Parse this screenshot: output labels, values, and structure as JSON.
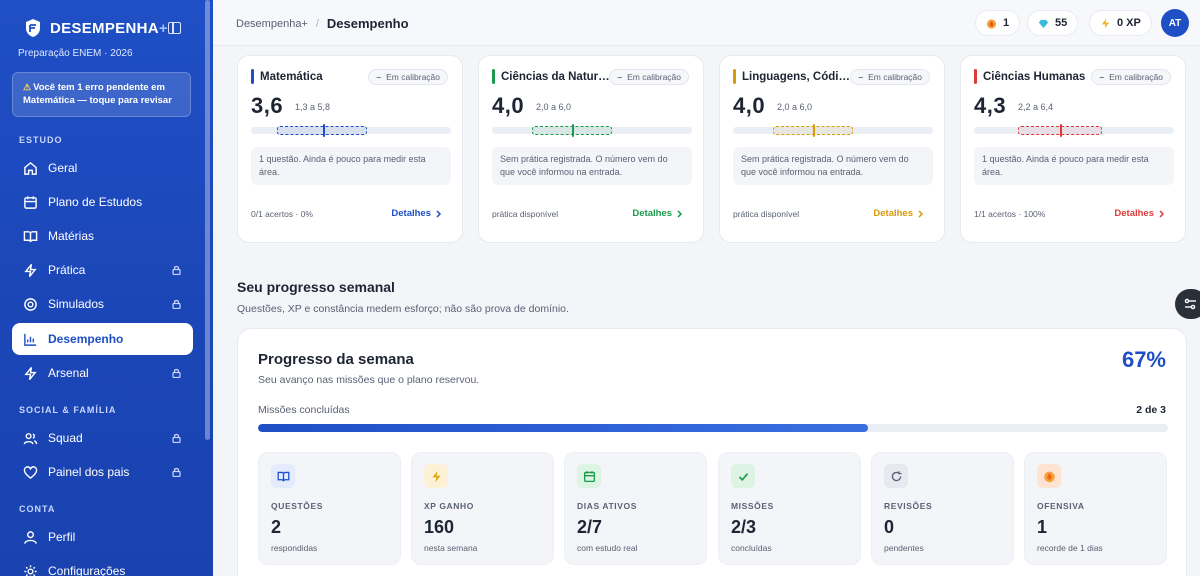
{
  "sidebar": {
    "brand": "DESEMPENHA",
    "brand_plus": "+",
    "subtitle": "Preparação ENEM · 2026",
    "alert": "Você tem 1 erro pendente em Matemática — toque para revisar",
    "sections": {
      "estudo": "ESTUDO",
      "social": "SOCIAL & FAMÍLIA",
      "conta": "CONTA"
    },
    "items": [
      {
        "label": "Geral",
        "icon": "home-icon",
        "locked": false
      },
      {
        "label": "Plano de Estudos",
        "icon": "calendar-icon",
        "locked": false
      },
      {
        "label": "Matérias",
        "icon": "book-icon",
        "locked": false
      },
      {
        "label": "Prática",
        "icon": "bolt-icon",
        "locked": true
      },
      {
        "label": "Simulados",
        "icon": "target-icon",
        "locked": true
      },
      {
        "label": "Desempenho",
        "icon": "chart-icon",
        "locked": false,
        "active": true
      },
      {
        "label": "Arsenal",
        "icon": "bolt-icon",
        "locked": true
      },
      {
        "label": "Squad",
        "icon": "users-icon",
        "locked": true
      },
      {
        "label": "Painel dos pais",
        "icon": "heart-icon",
        "locked": true
      },
      {
        "label": "Perfil",
        "icon": "user-icon",
        "locked": false
      },
      {
        "label": "Configurações",
        "icon": "gear-icon",
        "locked": false
      }
    ]
  },
  "header": {
    "breadcrumb_root": "Desempenha+",
    "breadcrumb_sep": "/",
    "breadcrumb_current": "Desempenho",
    "streak": "1",
    "gems": "55",
    "xp": "0 XP",
    "avatar": "AT"
  },
  "subjects": [
    {
      "title": "Matemática",
      "status": "Em calibração",
      "score": "3,6",
      "range": "1,3 a 5,8",
      "band_low": 1.3,
      "band_high": 5.8,
      "value": 3.6,
      "note": "1 questão. Ainda é pouco para medir esta área.",
      "footer": "0/1 acertos · 0%",
      "details": "Detalhes",
      "color": "#1e4fc4"
    },
    {
      "title": "Ciências da Natureza",
      "status": "Em calibração",
      "score": "4,0",
      "range": "2,0 a 6,0",
      "band_low": 2.0,
      "band_high": 6.0,
      "value": 4.0,
      "note": "Sem prática registrada. O número vem do que você informou na entrada.",
      "footer": "prática disponível",
      "details": "Detalhes",
      "color": "#1a9a4a"
    },
    {
      "title": "Linguagens, Códigos",
      "status": "Em calibração",
      "score": "4,0",
      "range": "2,0 a 6,0",
      "band_low": 2.0,
      "band_high": 6.0,
      "value": 4.0,
      "note": "Sem prática registrada. O número vem do que você informou na entrada.",
      "footer": "prática disponível",
      "details": "Detalhes",
      "color": "#d99a0a"
    },
    {
      "title": "Ciências Humanas",
      "status": "Em calibração",
      "score": "4,3",
      "range": "2,2 a 6,4",
      "band_low": 2.2,
      "band_high": 6.4,
      "value": 4.3,
      "note": "1 questão. Ainda é pouco para medir esta área.",
      "footer": "1/1 acertos · 100%",
      "details": "Detalhes",
      "color": "#dc3b3b"
    }
  ],
  "weekly": {
    "title": "Seu progresso semanal",
    "subtitle": "Questões, XP e constância medem esforço; não são prova de domínio.",
    "card_title": "Progresso da semana",
    "card_subtitle": "Seu avanço nas missões que o plano reservou.",
    "percent": "67%",
    "progress_fraction": 0.67,
    "missions_label": "Missões concluídas",
    "missions_count": "2 de 3",
    "stats": [
      {
        "label": "QUESTÕES",
        "value": "2",
        "caption": "respondidas",
        "icon": "book-icon",
        "color": "#1e4fc4",
        "bg": "#e3ebfd"
      },
      {
        "label": "XP GANHO",
        "value": "160",
        "caption": "nesta semana",
        "icon": "bolt-icon",
        "color": "#e0a50c",
        "bg": "#fdf1d5"
      },
      {
        "label": "DIAS ATIVOS",
        "value": "2/7",
        "caption": "com estudo real",
        "icon": "calendar-icon",
        "color": "#1a9a4a",
        "bg": "#ddf3e4"
      },
      {
        "label": "MISSÕES",
        "value": "2/3",
        "caption": "concluídas",
        "icon": "check-icon",
        "color": "#1a9a4a",
        "bg": "#ddf3e4"
      },
      {
        "label": "REVISÕES",
        "value": "0",
        "caption": "pendentes",
        "icon": "refresh-icon",
        "color": "#5a6173",
        "bg": "#e6e9f0"
      },
      {
        "label": "OFENSIVA",
        "value": "1",
        "caption": "recorde de 1 dias",
        "icon": "flame-icon",
        "color": "#ea6a1a",
        "bg": "#fde3d1"
      }
    ]
  }
}
